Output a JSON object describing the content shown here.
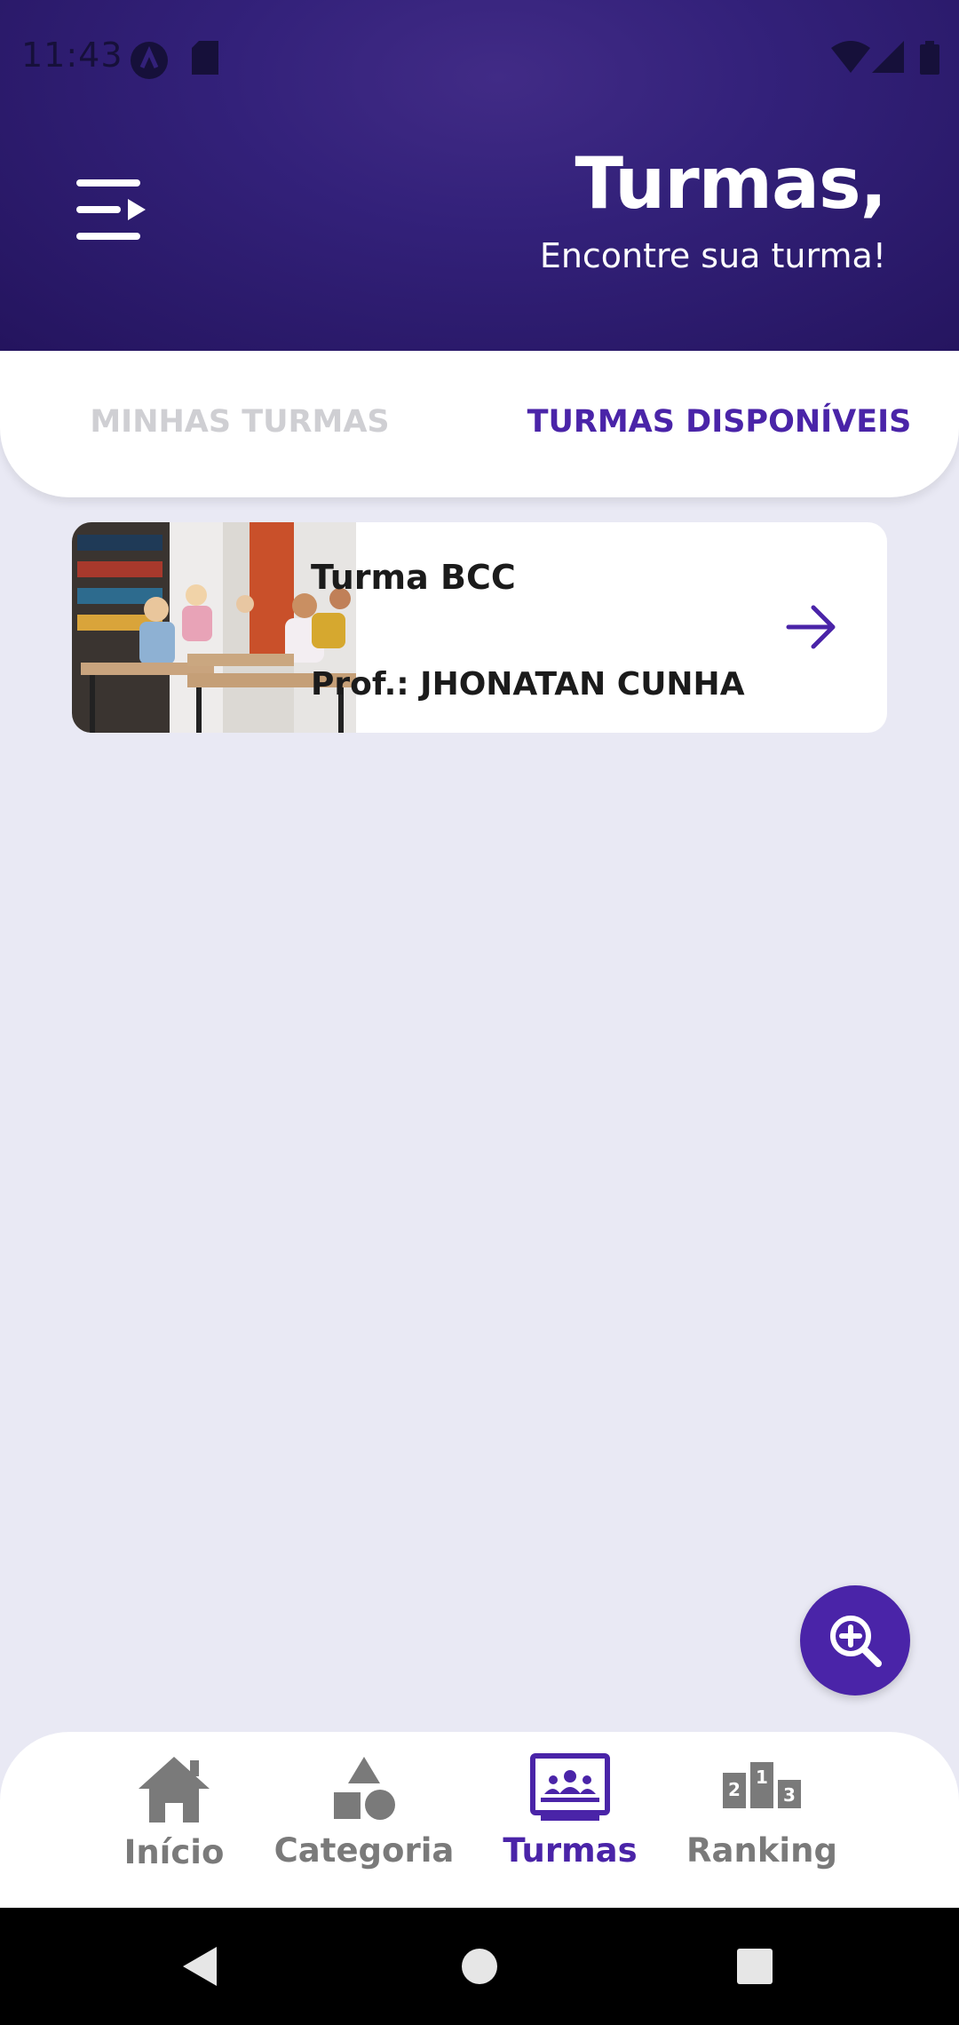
{
  "status_bar": {
    "time": "11:43"
  },
  "header": {
    "title": "Turmas,",
    "subtitle": "Encontre sua turma!"
  },
  "tabs": [
    {
      "label": "MINHAS TURMAS",
      "active": false
    },
    {
      "label": "TURMAS DISPONÍVEIS",
      "active": true
    }
  ],
  "classes": [
    {
      "title": "Turma BCC",
      "professor": "Prof.: JHONATAN CUNHA"
    }
  ],
  "bottom_nav": [
    {
      "label": "Início",
      "icon": "home-icon",
      "active": false
    },
    {
      "label": "Categoria",
      "icon": "shapes-icon",
      "active": false
    },
    {
      "label": "Turmas",
      "icon": "classroom-icon",
      "active": true
    },
    {
      "label": "Ranking",
      "icon": "podium-icon",
      "active": false
    }
  ],
  "colors": {
    "header_dark": "#24145e",
    "header_light": "#412b86",
    "accent": "#4a24a8",
    "background": "#e9e9f4",
    "inactive": "#7a7a7a"
  }
}
